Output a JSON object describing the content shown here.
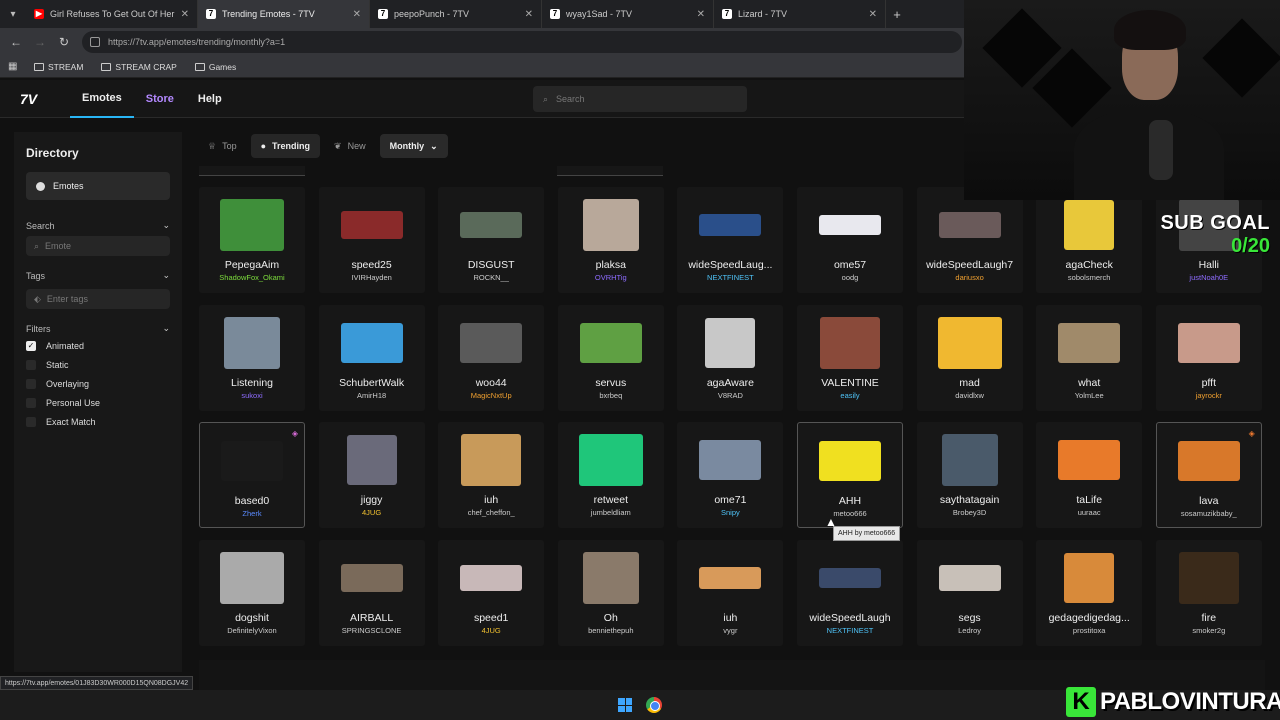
{
  "browser": {
    "tabs": [
      {
        "title": "Girl Refuses To Get Out Of Her",
        "fav_color": "#ff0000",
        "fav_glyph": "▶"
      },
      {
        "title": "Trending Emotes - 7TV",
        "fav_color": "#ffffff",
        "fav_glyph": "7"
      },
      {
        "title": "peepoPunch - 7TV",
        "fav_color": "#ffffff",
        "fav_glyph": "7"
      },
      {
        "title": "wyay1Sad - 7TV",
        "fav_color": "#ffffff",
        "fav_glyph": "7"
      },
      {
        "title": "Lizard - 7TV",
        "fav_color": "#ffffff",
        "fav_glyph": "7"
      }
    ],
    "url": "https://7tv.app/emotes/trending/monthly?a=1",
    "bookmarks": [
      "STREAM",
      "STREAM CRAP",
      "Games"
    ],
    "status_url": "https://7tv.app/emotes/01J83D30WR000D15QN08DGJV42"
  },
  "nav": {
    "links": [
      "Emotes",
      "Store",
      "Help"
    ],
    "search_placeholder": "Search"
  },
  "sidebar": {
    "title": "Directory",
    "directory_item": "Emotes",
    "search_label": "Search",
    "search_placeholder": "Emote",
    "tags_label": "Tags",
    "tags_placeholder": "Enter tags",
    "filters_label": "Filters",
    "filters": [
      {
        "label": "Animated",
        "checked": true
      },
      {
        "label": "Static",
        "checked": false
      },
      {
        "label": "Overlaying",
        "checked": false
      },
      {
        "label": "Personal Use",
        "checked": false
      },
      {
        "label": "Exact Match",
        "checked": false
      }
    ]
  },
  "filter_tabs": {
    "top": "Top",
    "trending": "Trending",
    "new": "New",
    "period": "Monthly"
  },
  "emotes": [
    [
      {
        "name": "PepegaAim",
        "owner": "ShadowFox_Okami",
        "owner_color": "#7cdc3c",
        "thumb": "#3f8f3a"
      },
      {
        "name": "speed25",
        "owner": "IVIRHayden",
        "owner_color": "#cccccc",
        "thumb": "#8a2a2a"
      },
      {
        "name": "DISGUST",
        "owner": "ROCKN__",
        "owner_color": "#cccccc",
        "thumb": "#5a6a5a"
      },
      {
        "name": "plaksa",
        "owner": "OVRHTig",
        "owner_color": "#8e6cff",
        "thumb": "#b8a89a"
      },
      {
        "name": "wideSpeedLaug...",
        "owner": "NEXTFINEST",
        "owner_color": "#4fc3f7",
        "thumb": "#2a4f8a"
      },
      {
        "name": "ome57",
        "owner": "oodg",
        "owner_color": "#cccccc",
        "thumb": "#e8e8ee"
      },
      {
        "name": "wideSpeedLaugh7",
        "owner": "dariusxo",
        "owner_color": "#f0a030",
        "thumb": "#6a5a5a"
      },
      {
        "name": "agaCheck",
        "owner": "sobolsmerch",
        "owner_color": "#cccccc",
        "thumb": "#e8c83a"
      },
      {
        "name": "Halli",
        "owner": "justNoah0E",
        "owner_color": "#8e6cff",
        "thumb": "#444444"
      }
    ],
    [
      {
        "name": "Listening",
        "owner": "sukoxi",
        "owner_color": "#8e6cff",
        "thumb": "#7a8a9a"
      },
      {
        "name": "SchubertWalk",
        "owner": "AmirH18",
        "owner_color": "#cccccc",
        "thumb": "#3a9ad8"
      },
      {
        "name": "woo44",
        "owner": "MagicNxtUp",
        "owner_color": "#f0a030",
        "thumb": "#5a5a5a"
      },
      {
        "name": "servus",
        "owner": "bxrbeq",
        "owner_color": "#cccccc",
        "thumb": "#5fa043"
      },
      {
        "name": "agaAware",
        "owner": "V8RAD",
        "owner_color": "#cccccc",
        "thumb": "#c8c8c8"
      },
      {
        "name": "VALENTINE",
        "owner": "easily",
        "owner_color": "#4fc3f7",
        "thumb": "#8a4a3a"
      },
      {
        "name": "mad",
        "owner": "davidlxw",
        "owner_color": "#cccccc",
        "thumb": "#f0b830"
      },
      {
        "name": "what",
        "owner": "YolmLee",
        "owner_color": "#cccccc",
        "thumb": "#a08a6a"
      },
      {
        "name": "pfft",
        "owner": "jayrockr",
        "owner_color": "#f0a030",
        "thumb": "#c89a8a"
      }
    ],
    [
      {
        "name": "based0",
        "owner": "Zherk",
        "owner_color": "#5a8aff",
        "thumb": "#1a1a1a",
        "bordered": true,
        "corner": "#d86bd8"
      },
      {
        "name": "jiggy",
        "owner": "4JUG",
        "owner_color": "#f0c030",
        "thumb": "#6a6a7a"
      },
      {
        "name": "iuh",
        "owner": "chef_cheffon_",
        "owner_color": "#cccccc",
        "thumb": "#c89a5a"
      },
      {
        "name": "retweet",
        "owner": "jumbeldliam",
        "owner_color": "#cccccc",
        "thumb": "#1fc67a"
      },
      {
        "name": "ome71",
        "owner": "Snipy",
        "owner_color": "#4fc3f7",
        "thumb": "#7a8aa0"
      },
      {
        "name": "AHH",
        "owner": "metoo666",
        "owner_color": "#cccccc",
        "thumb": "#f0e020",
        "bordered": true
      },
      {
        "name": "saythatagain",
        "owner": "Brobey3D",
        "owner_color": "#cccccc",
        "thumb": "#4a5a6a"
      },
      {
        "name": "taLife",
        "owner": "uuraac",
        "owner_color": "#cccccc",
        "thumb": "#e87a2a"
      },
      {
        "name": "lava",
        "owner": "sosamuzikbaby_",
        "owner_color": "#cccccc",
        "thumb": "#d8782a",
        "bordered": true,
        "corner": "#f07a30"
      }
    ],
    [
      {
        "name": "dogshit",
        "owner": "DefinitelyVixon",
        "owner_color": "#cccccc",
        "thumb": "#aaaaaa"
      },
      {
        "name": "AIRBALL",
        "owner": "SPRINGSCLONE",
        "owner_color": "#cccccc",
        "thumb": "#7a6a5a"
      },
      {
        "name": "speed1",
        "owner": "4JUG",
        "owner_color": "#f0c030",
        "thumb": "#c8b8b8"
      },
      {
        "name": "Oh",
        "owner": "benniethepuh",
        "owner_color": "#cccccc",
        "thumb": "#8a7a6a"
      },
      {
        "name": "iuh",
        "owner": "vygr",
        "owner_color": "#cccccc",
        "thumb": "#d89a5a"
      },
      {
        "name": "wideSpeedLaugh",
        "owner": "NEXTFINEST",
        "owner_color": "#4fc3f7",
        "thumb": "#3a4a6a"
      },
      {
        "name": "segs",
        "owner": "Ledroy",
        "owner_color": "#cccccc",
        "thumb": "#c8c0b8"
      },
      {
        "name": "gedagedigedag...",
        "owner": "prostitoxa",
        "owner_color": "#cccccc",
        "thumb": "#d88a3a"
      },
      {
        "name": "fire",
        "owner": "smoker2g",
        "owner_color": "#cccccc",
        "thumb": "#3a2a1a"
      }
    ]
  ],
  "tooltip": "AHH by metoo666",
  "overlay": {
    "sub_goal_label": "SUB GOAL",
    "sub_goal_value": "0/20",
    "brand_letter": "K",
    "brand_name": "PABLOVINTURA"
  }
}
